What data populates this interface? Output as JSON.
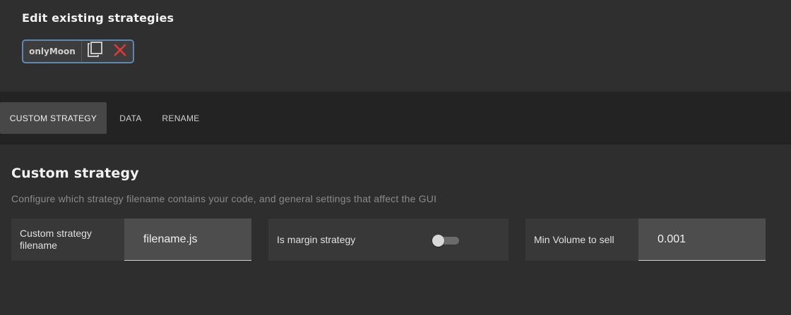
{
  "existing": {
    "title": "Edit existing strategies",
    "strategies": [
      {
        "name": "onlyMoon",
        "actions": [
          "copy-icon",
          "delete-icon"
        ]
      }
    ],
    "chip_border_color": "#5f87b3",
    "delete_color": "#e53935"
  },
  "tabs": [
    {
      "label": "CUSTOM STRATEGY",
      "active": true
    },
    {
      "label": "DATA",
      "active": false
    },
    {
      "label": "RENAME",
      "active": false
    }
  ],
  "main": {
    "title": "Custom strategy",
    "description": "Configure which strategy filename contains your code, and general settings that affect the GUI",
    "fields": {
      "filename": {
        "label": "Custom strategy filename",
        "value": "filename.js"
      },
      "margin": {
        "label": "Is margin strategy",
        "checked": false
      },
      "min_volume": {
        "label": "Min Volume to sell",
        "value": "0.001"
      }
    }
  }
}
